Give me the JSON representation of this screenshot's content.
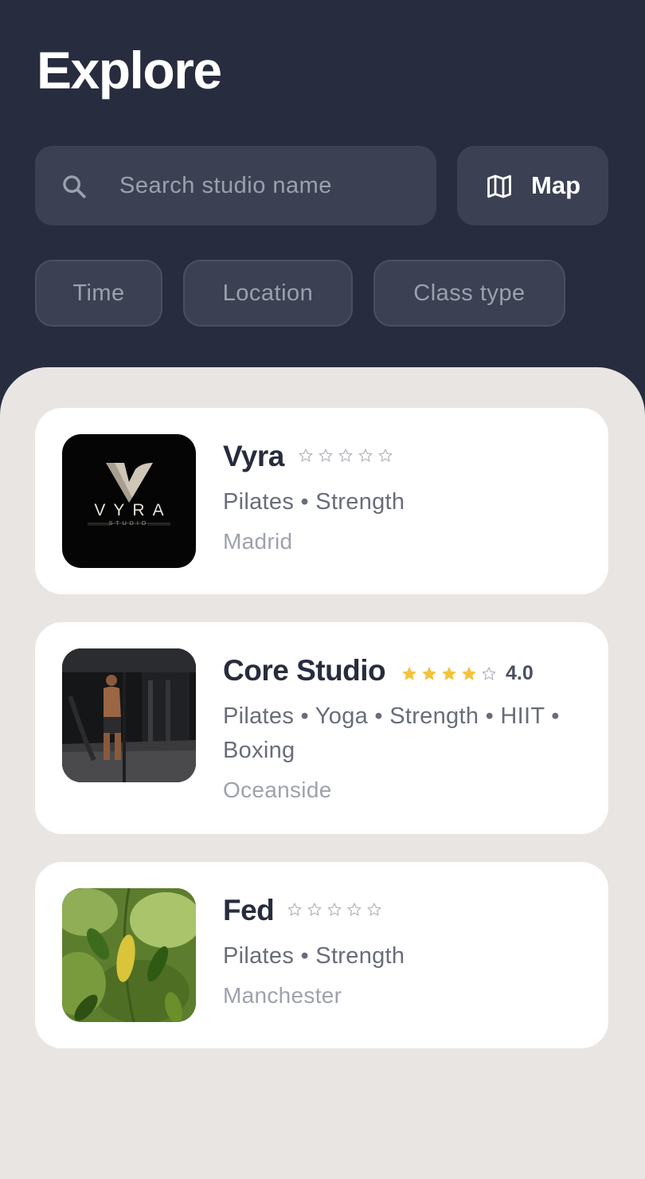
{
  "header": {
    "title": "Explore",
    "search": {
      "placeholder": "Search studio name",
      "value": "",
      "icon": "search-icon"
    },
    "map_button": {
      "label": "Map",
      "icon": "map-icon"
    },
    "filters": [
      "Time",
      "Location",
      "Class type"
    ]
  },
  "colors": {
    "header_bg": "#272c3e",
    "control_bg": "#3b4152",
    "sheet_bg": "#e8e5e2",
    "card_bg": "#ffffff",
    "star_filled": "#f4c33d",
    "star_empty": "#b8bbc2"
  },
  "studios": [
    {
      "name": "Vyra",
      "rating": null,
      "stars_filled": 0,
      "stars_total": 5,
      "tags": "Pilates • Strength",
      "city": "Madrid",
      "logo": {
        "wordmark": "VYRA",
        "subtitle": "STUDIO"
      }
    },
    {
      "name": "Core Studio",
      "rating": "4.0",
      "stars_filled": 4,
      "stars_total": 5,
      "tags": "Pilates • Yoga • Strength • HIIT • Boxing",
      "city": "Oceanside"
    },
    {
      "name": "Fed",
      "rating": null,
      "stars_filled": 0,
      "stars_total": 5,
      "tags": "Pilates • Strength",
      "city": "Manchester"
    }
  ]
}
